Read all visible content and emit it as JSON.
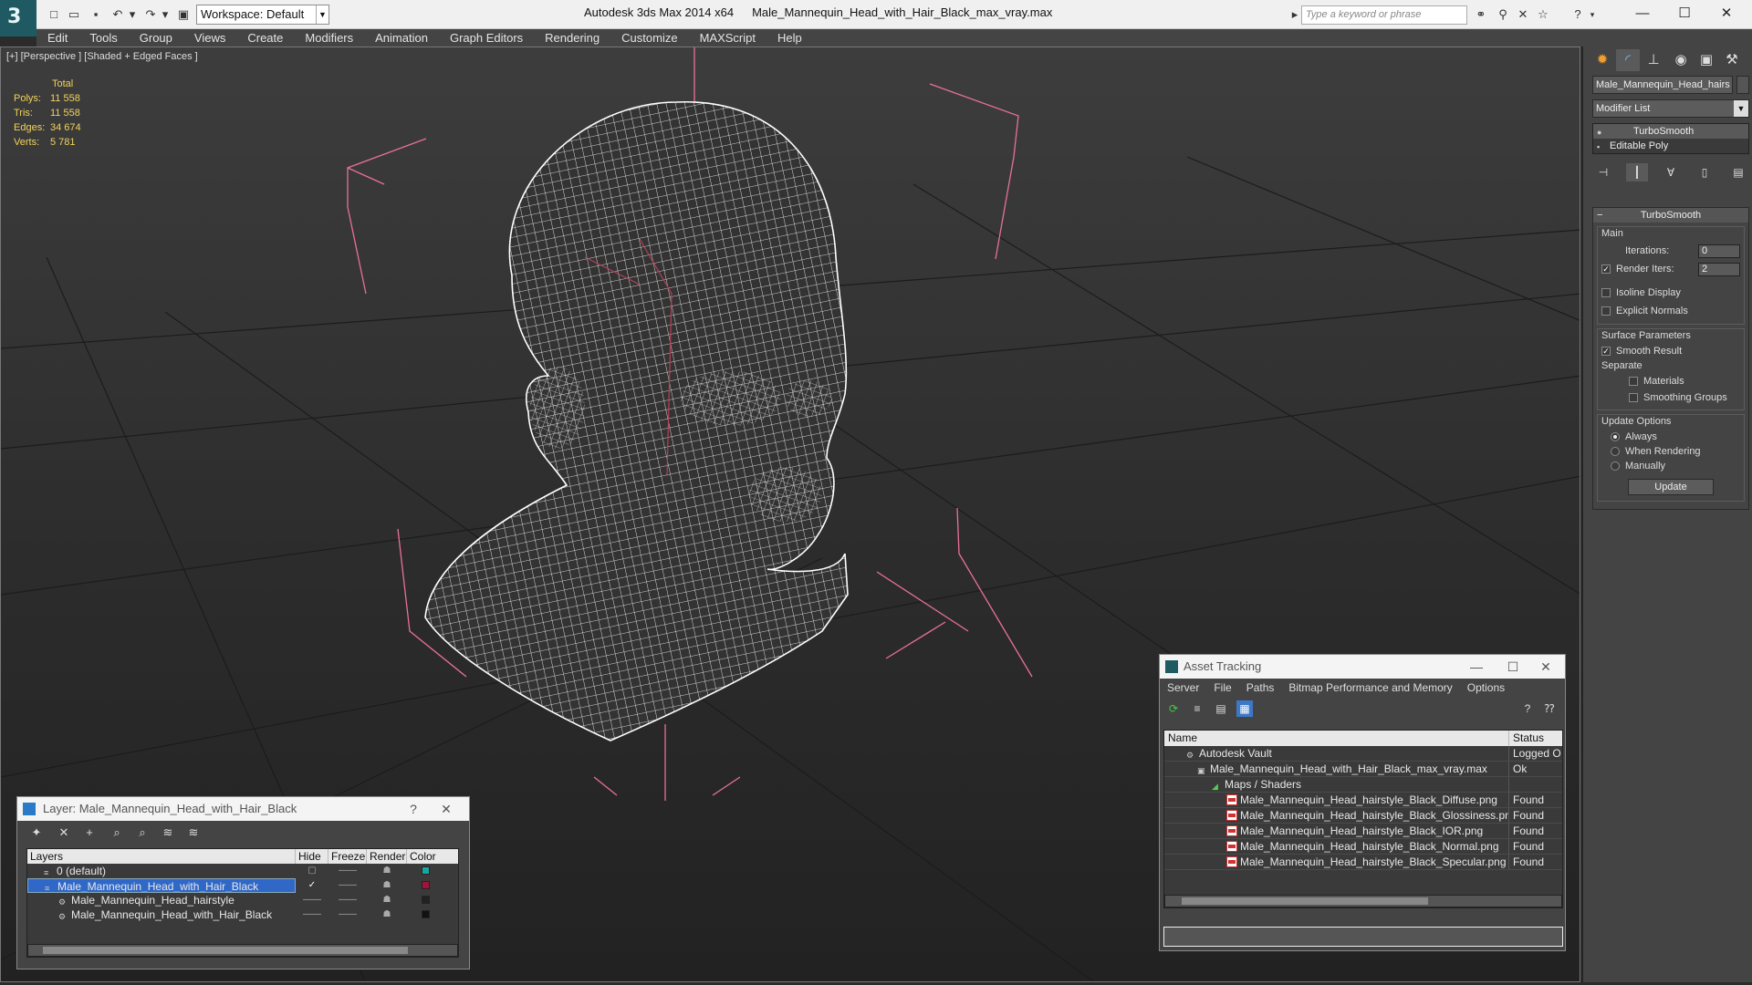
{
  "titlebar": {
    "app_title": "Autodesk 3ds Max  2014 x64",
    "file_title": "Male_Mannequin_Head_with_Hair_Black_max_vray.max",
    "workspace": "Workspace: Default",
    "search_placeholder": "Type a keyword or phrase"
  },
  "menu": [
    "Edit",
    "Tools",
    "Group",
    "Views",
    "Create",
    "Modifiers",
    "Animation",
    "Graph Editors",
    "Rendering",
    "Customize",
    "MAXScript",
    "Help"
  ],
  "viewport": {
    "label": "[+] [Perspective ] [Shaded + Edged Faces ]",
    "stats_header": "Total",
    "stats": [
      {
        "k": "Polys:",
        "v": "11 558"
      },
      {
        "k": "Tris:",
        "v": "11 558"
      },
      {
        "k": "Edges:",
        "v": "34 674"
      },
      {
        "k": "Verts:",
        "v": "5 781"
      }
    ],
    "colors": {
      "wire": "#ffffff",
      "bbox": "#e8709a",
      "grid": "#1e1e1e"
    }
  },
  "command_panel": {
    "object_name": "Male_Mannequin_Head_hairs",
    "modifier_list": "Modifier List",
    "stack": [
      "TurboSmooth",
      "Editable Poly"
    ],
    "rollout_title": "TurboSmooth",
    "main_label": "Main",
    "iterations_label": "Iterations:",
    "iterations_value": "0",
    "render_iters_label": "Render Iters:",
    "render_iters_value": "2",
    "isoline": "Isoline Display",
    "explicit_normals": "Explicit Normals",
    "surface_params": "Surface Parameters",
    "smooth_result": "Smooth Result",
    "separate": "Separate",
    "materials": "Materials",
    "smoothing_groups": "Smoothing Groups",
    "update_options": "Update Options",
    "always": "Always",
    "when_rendering": "When Rendering",
    "manually": "Manually",
    "update_btn": "Update"
  },
  "asset_tracking": {
    "title": "Asset Tracking",
    "menu": [
      "Server",
      "File",
      "Paths",
      "Bitmap Performance and Memory",
      "Options"
    ],
    "col_name": "Name",
    "col_status": "Status",
    "rows": [
      {
        "name": "Autodesk Vault",
        "status": "Logged O"
      },
      {
        "name": "Male_Mannequin_Head_with_Hair_Black_max_vray.max",
        "status": "Ok"
      },
      {
        "name": "Maps / Shaders",
        "status": ""
      },
      {
        "name": "Male_Mannequin_Head_hairstyle_Black_Diffuse.png",
        "status": "Found"
      },
      {
        "name": "Male_Mannequin_Head_hairstyle_Black_Glossiness.png",
        "status": "Found"
      },
      {
        "name": "Male_Mannequin_Head_hairstyle_Black_IOR.png",
        "status": "Found"
      },
      {
        "name": "Male_Mannequin_Head_hairstyle_Black_Normal.png",
        "status": "Found"
      },
      {
        "name": "Male_Mannequin_Head_hairstyle_Black_Specular.png",
        "status": "Found"
      }
    ]
  },
  "layer_dialog": {
    "title": "Layer: Male_Mannequin_Head_with_Hair_Black",
    "help": "?",
    "cols": [
      "Layers",
      "Hide",
      "Freeze",
      "Render",
      "Color"
    ],
    "rows": [
      {
        "name": "0 (default)",
        "color": "#1aa6a0"
      },
      {
        "name": "Male_Mannequin_Head_with_Hair_Black",
        "color": "#a0143c"
      },
      {
        "name": "Male_Mannequin_Head_hairstyle",
        "color": "#222222"
      },
      {
        "name": "Male_Mannequin_Head_with_Hair_Black",
        "color": "#111111"
      }
    ]
  }
}
